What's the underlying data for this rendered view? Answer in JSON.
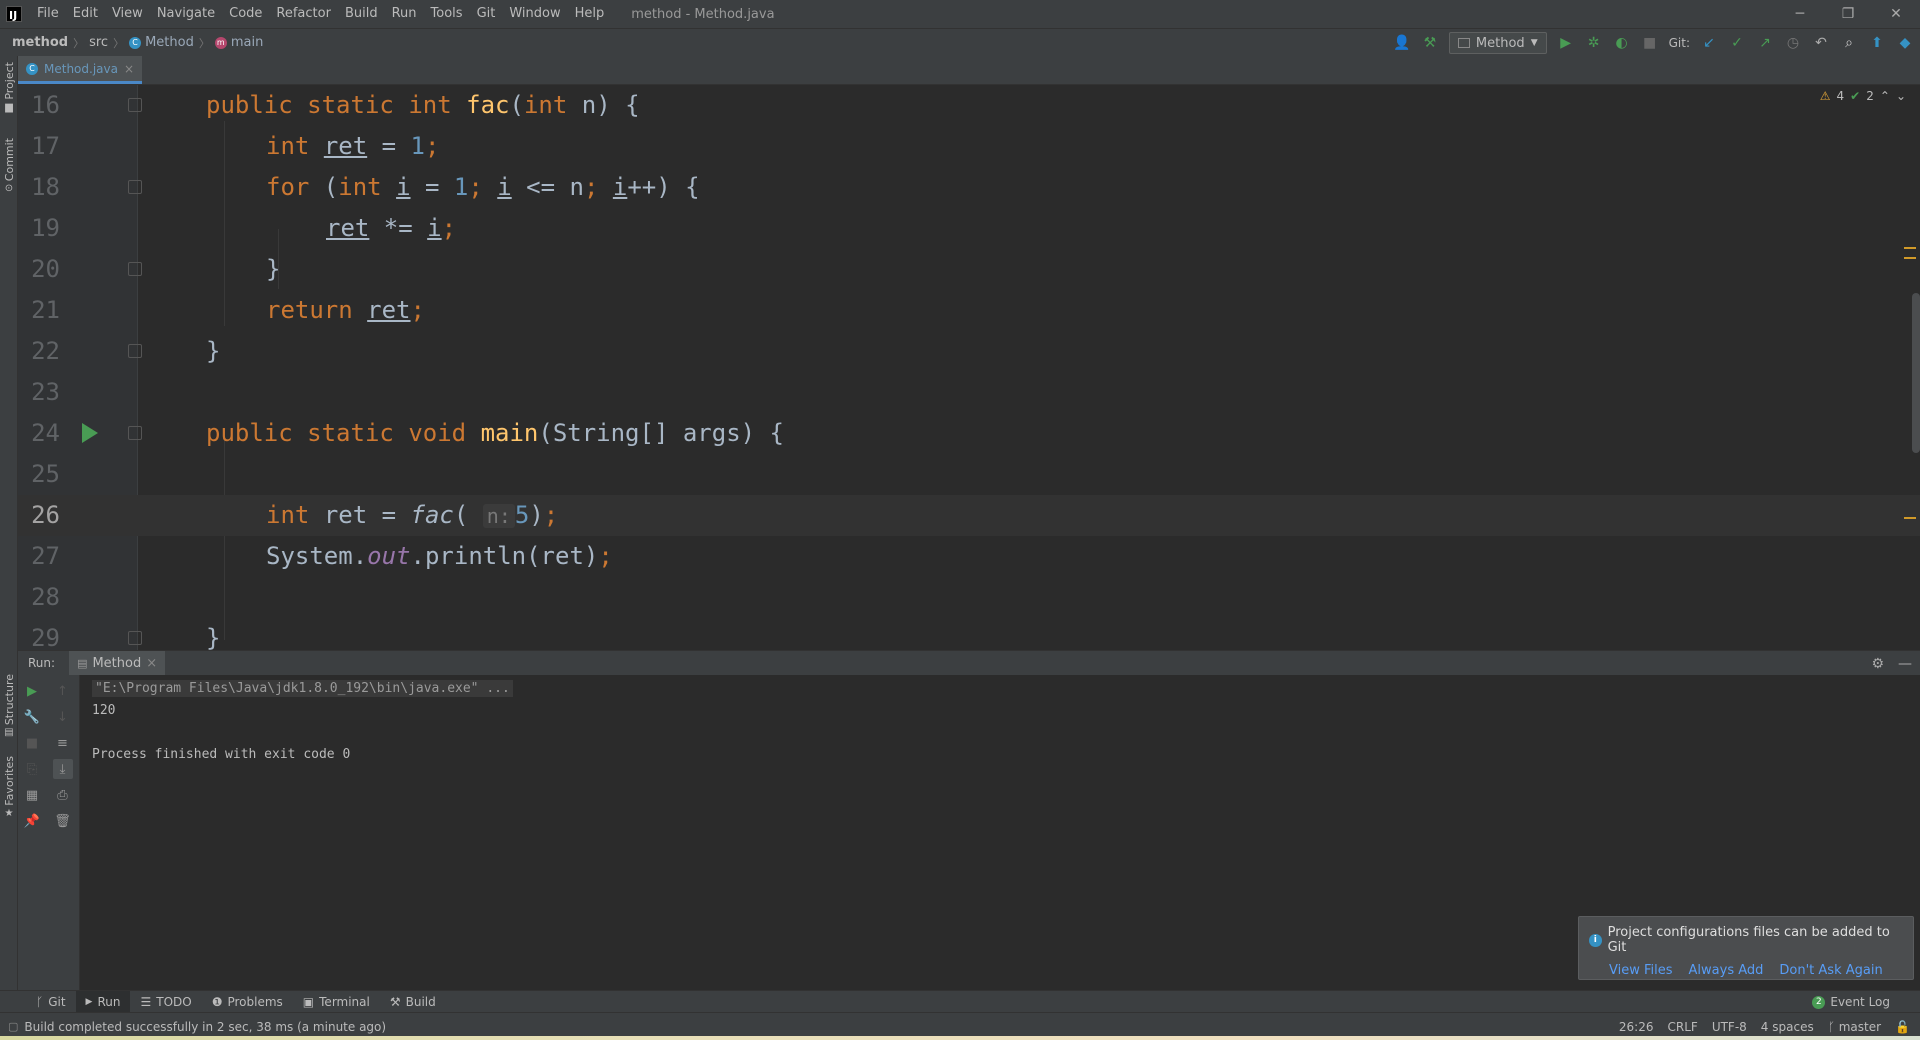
{
  "titlebar": {
    "logo": "IJ",
    "menu": [
      "File",
      "Edit",
      "View",
      "Navigate",
      "Code",
      "Refactor",
      "Build",
      "Run",
      "Tools",
      "Git",
      "Window",
      "Help"
    ],
    "window_title": "method - Method.java",
    "min": "─",
    "restore": "❐",
    "close": "✕"
  },
  "navbar": {
    "project": "method",
    "src": "src",
    "class": "Method",
    "method": "main",
    "run_config": "Method",
    "git_label": "Git:"
  },
  "left_strip": {
    "project": "Project",
    "commit": "Commit",
    "structure": "Structure",
    "favorites": "Favorites"
  },
  "editor_tabs": [
    {
      "label": "Method.java",
      "close": "×"
    }
  ],
  "inspections": {
    "warnings": "4",
    "weak_warnings": "2"
  },
  "code": [
    {
      "n": "16"
    },
    {
      "n": "17"
    },
    {
      "n": "18"
    },
    {
      "n": "19"
    },
    {
      "n": "20"
    },
    {
      "n": "21"
    },
    {
      "n": "22"
    },
    {
      "n": "23"
    },
    {
      "n": "24"
    },
    {
      "n": "25"
    },
    {
      "n": "26"
    },
    {
      "n": "27"
    },
    {
      "n": "28"
    },
    {
      "n": "29"
    }
  ],
  "tokens": {
    "public": "public",
    "static": "static",
    "int": "int",
    "void": "void",
    "for": "for",
    "return": "return",
    "fac": "fac",
    "main": "main",
    "n": "n",
    "ret": "ret",
    "i": "i",
    "one": "1",
    "five": "5",
    "hint_n": "n:",
    "string_args": "String[] args",
    "system": "System.",
    "out": "out",
    "println": ".println(ret)",
    "open_sig": "(",
    "int_n": "int",
    "close_sig": " n) {",
    "brace_close": "}"
  },
  "run_panel": {
    "title": "Run:",
    "tab": "Method",
    "tab_close": "×",
    "console": {
      "cmd": "\"E:\\Program Files\\Java\\jdk1.8.0_192\\bin\\java.exe\" ...",
      "output": "120",
      "exit": "Process finished with exit code 0"
    }
  },
  "notification": {
    "message": "Project configurations files can be added to Git",
    "actions": [
      "View Files",
      "Always Add",
      "Don't Ask Again"
    ]
  },
  "bottom_tabs": [
    "Git",
    "Run",
    "TODO",
    "Problems",
    "Terminal",
    "Build"
  ],
  "event_log": {
    "label": "Event Log",
    "count": "2"
  },
  "status": {
    "build": "Build completed successfully in 2 sec, 38 ms (a minute ago)",
    "position": "26:26",
    "line_sep": "CRLF",
    "encoding": "UTF-8",
    "indent": "4 spaces",
    "branch": "master"
  },
  "colors": {
    "keyword": "#cc7832",
    "number": "#6897bb",
    "function": "#ffc66d",
    "field": "#9876aa",
    "run_green": "#499c54",
    "accent_blue": "#3592c4"
  }
}
